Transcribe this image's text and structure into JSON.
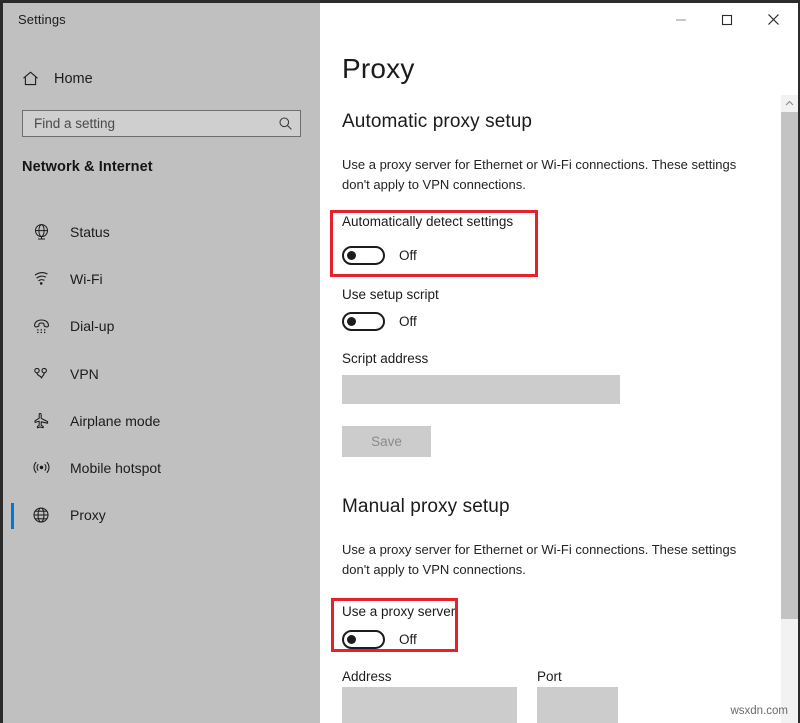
{
  "window": {
    "app_title": "Settings",
    "controls": {
      "minimize": "minimize-icon",
      "maximize": "maximize-icon",
      "close": "close-icon"
    }
  },
  "sidebar": {
    "home_label": "Home",
    "home_icon": "home-icon",
    "search": {
      "placeholder": "Find a setting",
      "value": "",
      "icon": "search-icon"
    },
    "category": "Network & Internet",
    "items": [
      {
        "label": "Status",
        "icon": "globe-status-icon",
        "selected": false
      },
      {
        "label": "Wi-Fi",
        "icon": "wifi-icon",
        "selected": false
      },
      {
        "label": "Dial-up",
        "icon": "dialup-phone-icon",
        "selected": false
      },
      {
        "label": "VPN",
        "icon": "vpn-icon",
        "selected": false
      },
      {
        "label": "Airplane mode",
        "icon": "airplane-icon",
        "selected": false
      },
      {
        "label": "Mobile hotspot",
        "icon": "hotspot-icon",
        "selected": false
      },
      {
        "label": "Proxy",
        "icon": "globe-proxy-icon",
        "selected": true
      }
    ]
  },
  "main": {
    "page_title": "Proxy",
    "automatic": {
      "heading": "Automatic proxy setup",
      "description": "Use a proxy server for Ethernet or Wi-Fi connections. These settings don't apply to VPN connections.",
      "auto_detect": {
        "label": "Automatically detect settings",
        "state": "Off",
        "highlighted": true
      },
      "setup_script": {
        "label": "Use setup script",
        "state": "Off"
      },
      "script_address": {
        "label": "Script address",
        "value": ""
      },
      "save_label": "Save"
    },
    "manual": {
      "heading": "Manual proxy setup",
      "description": "Use a proxy server for Ethernet or Wi-Fi connections. These settings don't apply to VPN connections.",
      "use_proxy": {
        "label": "Use a proxy server",
        "state": "Off",
        "highlighted": true
      },
      "address": {
        "label": "Address",
        "value": ""
      },
      "port": {
        "label": "Port",
        "value": ""
      }
    }
  },
  "scrollbar": {
    "up_arrow": "chevron-up-icon"
  },
  "watermark": "wsxdn.com",
  "colors": {
    "accent": "#0078d7",
    "highlight_box": "#e8202a",
    "sidebar_bg": "#c0c0c0",
    "disabled_field": "#cccccc"
  }
}
